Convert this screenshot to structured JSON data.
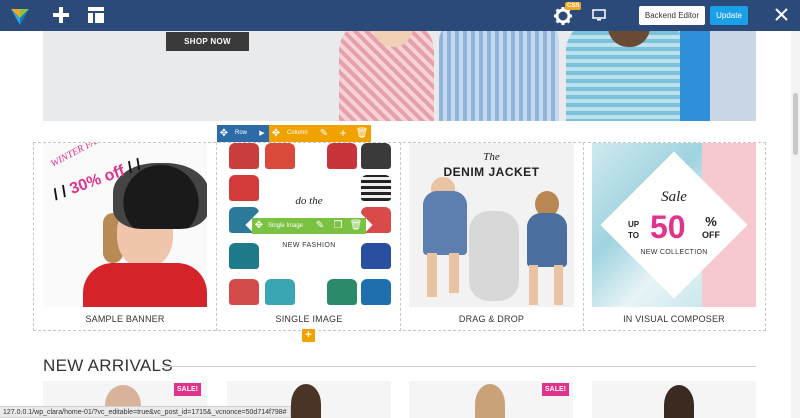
{
  "toolbar": {
    "backend_editor_label": "Backend Editor",
    "update_label": "Update",
    "badge_label": "CSS"
  },
  "hero": {
    "shop_now_label": "SHOP NOW"
  },
  "tiles": [
    {
      "caption": "SAMPLE BANNER",
      "line1": "WINTER FASHION",
      "line2": "30% off"
    },
    {
      "caption": "SINGLE IMAGE",
      "line1": "do the",
      "line2": "NEW FASHION"
    },
    {
      "caption": "DRAG & DROP",
      "line1": "The",
      "line2": "DENIM JACKET"
    },
    {
      "caption": "IN VISUAL COMPOSER",
      "line1": "Sale",
      "line2": "UP TO",
      "line3": "50",
      "line4": "%",
      "line5": "OFF",
      "line6": "NEW COLLECTION"
    }
  ],
  "controls": {
    "row_label": "Row",
    "column_label": "Column",
    "single_image_label": "Single Image"
  },
  "section": {
    "new_arrivals_title": "NEW ARRIVALS",
    "sale_badge": "SALE!"
  },
  "status_url": "127.0.0.1/wp_clara/home-01/?vc_editable=true&vc_post_id=1715&_vcnonce=50d714f798#",
  "colors": {
    "toolbar_bg": "#2b4a7a",
    "update_button": "#1aa0e6",
    "row_control": "#2d6aa8",
    "column_control": "#f0a300",
    "element_control": "#7cc242",
    "accent_pink": "#e2338c"
  }
}
